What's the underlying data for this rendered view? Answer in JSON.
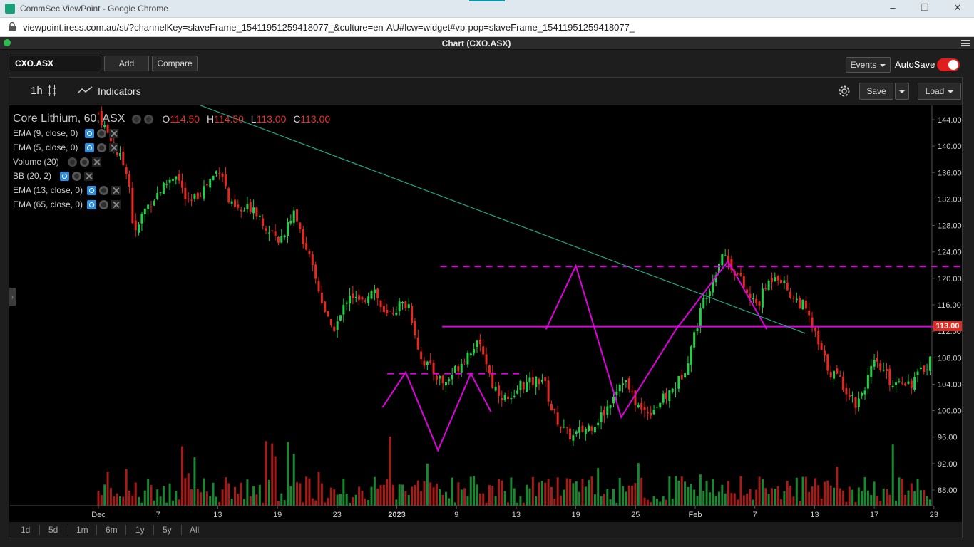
{
  "browser": {
    "window_title": "CommSec ViewPoint - Google Chrome",
    "url": "viewpoint.iress.com.au/st/?channelKey=slaveFrame_15411951259418077_&culture=en-AU#lcw=widget#vp-pop=slaveFrame_15411951259418077_"
  },
  "app": {
    "window_title": "Chart (CXO.ASX)"
  },
  "toolbar": {
    "symbol": "CXO.ASX",
    "add_label": "Add",
    "compare_label": "Compare",
    "events_label": "Events",
    "autosave_label": "AutoSave",
    "autosave_on": true
  },
  "chart_toolbar": {
    "interval": "1h",
    "indicators_label": "Indicators",
    "save_label": "Save",
    "load_label": "Load"
  },
  "legend": {
    "title": "Core Lithium, 60, ASX",
    "o_label": "O",
    "o_value": "114.50",
    "h_label": "H",
    "h_value": "114.50",
    "l_label": "L",
    "l_value": "113.00",
    "c_label": "C",
    "c_value": "113.00",
    "studies": [
      "EMA (9, close, 0)",
      "EMA (5, close, 0)",
      "Volume (20)",
      "BB (20, 2)",
      "EMA (13, close, 0)",
      "EMA (65, close, 0)"
    ]
  },
  "colors": {
    "up": "#22d048",
    "down": "#e8281f",
    "annotation": "#e000e0",
    "trendline": "#20a88a"
  },
  "chart_data": {
    "type": "candlestick",
    "title": "Core Lithium, 60, ASX",
    "y_ticks": [
      "144.00",
      "140.00",
      "136.00",
      "132.00",
      "128.00",
      "124.00",
      "120.00",
      "116.00",
      "112.00",
      "108.00",
      "104.00",
      "100.00",
      "96.00",
      "92.00",
      "88.00"
    ],
    "ylim": [
      85.2,
      144.6
    ],
    "x_ticks": [
      "Dec",
      "7",
      "13",
      "19",
      "23",
      "2023",
      "9",
      "13",
      "19",
      "25",
      "Feb",
      "7",
      "13",
      "17",
      "23"
    ],
    "last_price": "113.00",
    "close_path": [
      [
        0,
        145
      ],
      [
        0.25,
        140
      ],
      [
        0.5,
        136
      ],
      [
        0.6,
        126
      ],
      [
        0.75,
        130
      ],
      [
        1,
        133
      ],
      [
        1.3,
        136
      ],
      [
        1.5,
        131
      ],
      [
        1.8,
        134
      ],
      [
        2.05,
        137
      ],
      [
        2.2,
        131
      ],
      [
        2.4,
        130
      ],
      [
        2.6,
        131
      ],
      [
        2.8,
        128
      ],
      [
        3.05,
        126
      ],
      [
        3.3,
        130
      ],
      [
        3.5,
        124
      ],
      [
        3.7,
        118
      ],
      [
        3.9,
        112
      ],
      [
        4.05,
        114
      ],
      [
        4.2,
        118
      ],
      [
        4.4,
        116
      ],
      [
        4.6,
        119
      ],
      [
        4.8,
        114
      ],
      [
        5.05,
        116
      ],
      [
        5.2,
        116
      ],
      [
        5.4,
        108
      ],
      [
        5.6,
        106
      ],
      [
        5.8,
        104
      ],
      [
        6.05,
        107
      ],
      [
        6.3,
        110
      ],
      [
        6.45,
        109
      ],
      [
        6.6,
        104
      ],
      [
        6.8,
        102
      ],
      [
        6.95,
        101
      ],
      [
        7.05,
        104
      ],
      [
        7.2,
        104
      ],
      [
        7.45,
        105
      ],
      [
        7.6,
        100
      ],
      [
        7.8,
        97
      ],
      [
        7.95,
        96
      ],
      [
        8.1,
        97
      ],
      [
        8.3,
        98
      ],
      [
        8.5,
        100
      ],
      [
        8.65,
        103
      ],
      [
        8.8,
        105
      ],
      [
        8.95,
        102
      ],
      [
        9.1,
        100
      ],
      [
        9.25,
        100
      ],
      [
        9.5,
        102
      ],
      [
        9.7,
        104
      ],
      [
        9.85,
        107
      ],
      [
        10.0,
        112
      ],
      [
        10.15,
        117
      ],
      [
        10.3,
        120
      ],
      [
        10.45,
        124
      ],
      [
        10.6,
        122
      ],
      [
        10.75,
        120
      ],
      [
        10.9,
        117
      ],
      [
        11.05,
        116
      ],
      [
        11.2,
        119
      ],
      [
        11.35,
        121
      ],
      [
        11.5,
        119
      ],
      [
        11.65,
        117
      ],
      [
        11.8,
        116
      ],
      [
        11.95,
        113
      ],
      [
        12.1,
        109
      ],
      [
        12.25,
        106
      ],
      [
        12.4,
        105
      ],
      [
        12.55,
        103
      ],
      [
        12.7,
        101
      ],
      [
        12.85,
        104
      ],
      [
        13.0,
        107
      ],
      [
        13.15,
        106
      ],
      [
        13.3,
        104
      ],
      [
        13.45,
        105
      ],
      [
        13.6,
        104
      ],
      [
        13.8,
        106
      ],
      [
        13.95,
        108
      ],
      [
        14.1,
        111
      ],
      [
        14.25,
        113
      ],
      [
        14.4,
        111
      ],
      [
        14.6,
        112
      ],
      [
        14.8,
        113
      ],
      [
        14.95,
        112
      ],
      [
        15.1,
        113
      ],
      [
        15.25,
        116
      ],
      [
        15.4,
        118
      ],
      [
        15.5,
        121
      ],
      [
        15.6,
        122
      ],
      [
        15.75,
        118
      ],
      [
        15.9,
        116
      ],
      [
        16.05,
        114
      ],
      [
        16.2,
        113
      ],
      [
        16.35,
        114
      ],
      [
        16.45,
        113
      ]
    ],
    "volume_max": 100,
    "annotations": {
      "horizontal_lines": [
        {
          "y": 121.8,
          "x_from": 5.73,
          "x_to": 14.9,
          "style": "dashed"
        },
        {
          "y": 105.6,
          "x_from": 4.84,
          "x_to": 7.1,
          "style": "dashed"
        },
        {
          "y": 112.7,
          "x_from": 5.76,
          "x_to": 14.5,
          "style": "solid"
        }
      ],
      "zigzags": [
        [
          [
            4.76,
            100.5
          ],
          [
            5.15,
            105.8
          ],
          [
            5.69,
            94.0
          ],
          [
            6.24,
            105.6
          ],
          [
            6.58,
            99.8
          ]
        ],
        [
          [
            7.5,
            112.3
          ],
          [
            8.0,
            121.9
          ],
          [
            8.76,
            99.0
          ],
          [
            9.68,
            112.3
          ],
          [
            10.55,
            122.6
          ],
          [
            11.2,
            112.3
          ]
        ]
      ],
      "trendline": [
        [
          1.17,
          148.0
        ],
        [
          11.84,
          111.7
        ]
      ]
    }
  },
  "range_buttons": [
    "1d",
    "5d",
    "1m",
    "6m",
    "1y",
    "5y",
    "All"
  ]
}
